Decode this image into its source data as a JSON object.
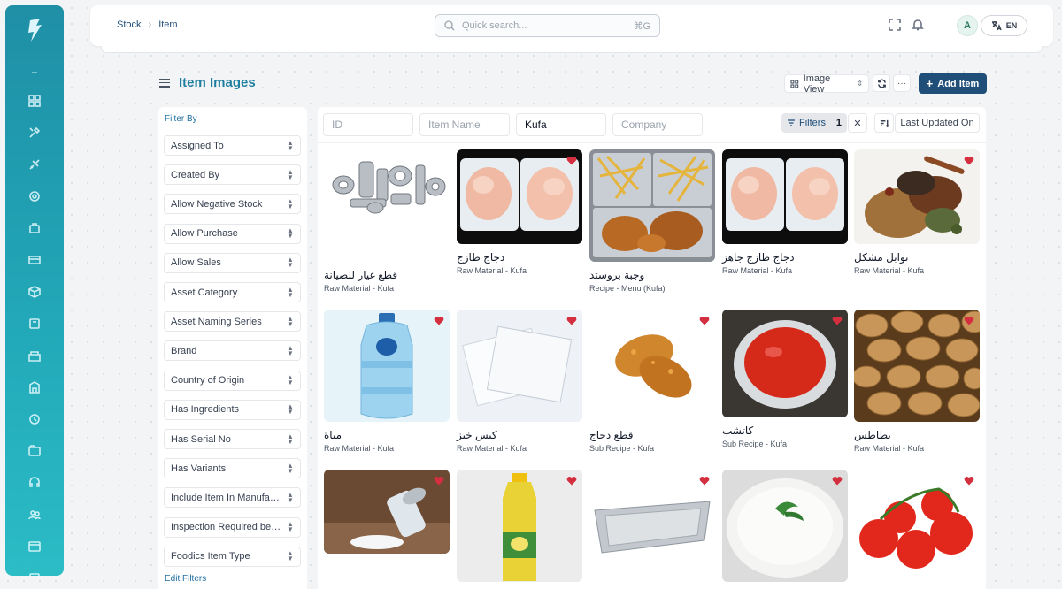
{
  "breadcrumb": {
    "items": [
      "Stock",
      "Item"
    ]
  },
  "search": {
    "placeholder": "Quick search...",
    "shortcut": "⌘G"
  },
  "user": {
    "initial": "A"
  },
  "language": {
    "label": "EN"
  },
  "page": {
    "title": "Item Images"
  },
  "toolbar": {
    "view_label": "Image View",
    "more_label": "···",
    "add_label": "Add Item"
  },
  "filter_panel": {
    "title": "Filter By",
    "filters": [
      "Assigned To",
      "Created By",
      "Allow Negative Stock",
      "Allow Purchase",
      "Allow Sales",
      "Asset Category",
      "Asset Naming Series",
      "Brand",
      "Country of Origin",
      "Has Ingredients",
      "Has Serial No",
      "Has Variants",
      "Include Item In Manufacturing",
      "Inspection Required before Purchase",
      "Foodics Item Type"
    ],
    "edit_label": "Edit Filters"
  },
  "list_filters": {
    "id_placeholder": "ID",
    "name_placeholder": "Item Name",
    "group_value": "Kufa",
    "company_placeholder": "Company",
    "filters_label": "Filters",
    "filters_count": "1",
    "clear_label": "✕",
    "sort_label": "Last Updated On"
  },
  "items": [
    {
      "name": "قطع غيار للصيانة",
      "sub": "Raw Material - Kufa",
      "image": "machine-parts",
      "liked": false
    },
    {
      "name": "دجاج طازج",
      "sub": "Raw Material - Kufa",
      "image": "chicken-tray",
      "liked": true
    },
    {
      "name": "وجبة بروستد",
      "sub": "Recipe - Menu (Kufa)",
      "image": "fried-meal",
      "liked": false
    },
    {
      "name": "دجاج طازج جاهز",
      "sub": "Raw Material - Kufa",
      "image": "chicken-tray",
      "liked": false
    },
    {
      "name": "توابل مشكل",
      "sub": "Raw Material - Kufa",
      "image": "spices",
      "liked": true
    },
    {
      "name": "مياة",
      "sub": "Raw Material - Kufa",
      "image": "water-bottle",
      "liked": true
    },
    {
      "name": "كيس خبز",
      "sub": "Raw Material - Kufa",
      "image": "plastic-bags",
      "liked": true
    },
    {
      "name": "قطع دجاج",
      "sub": "Sub Recipe - Kufa",
      "image": "fried-chicken",
      "liked": true
    },
    {
      "name": "كاتشب",
      "sub": "Sub Recipe - Kufa",
      "image": "ketchup",
      "liked": true
    },
    {
      "name": "بطاطس",
      "sub": "Raw Material - Kufa",
      "image": "potatoes",
      "liked": true
    },
    {
      "name": "",
      "sub": "",
      "image": "salt",
      "liked": true
    },
    {
      "name": "",
      "sub": "",
      "image": "oil-bottle",
      "liked": true
    },
    {
      "name": "",
      "sub": "",
      "image": "foil-tray",
      "liked": true
    },
    {
      "name": "",
      "sub": "",
      "image": "garlic-sauce",
      "liked": true
    },
    {
      "name": "",
      "sub": "",
      "image": "tomatoes",
      "liked": true
    }
  ],
  "colors": {
    "primary": "#1f4e79",
    "accent": "#1f7fa0",
    "heart": "#d32f3f",
    "sidebar_top": "#1f8fa6",
    "sidebar_bottom": "#2bbcc6"
  }
}
